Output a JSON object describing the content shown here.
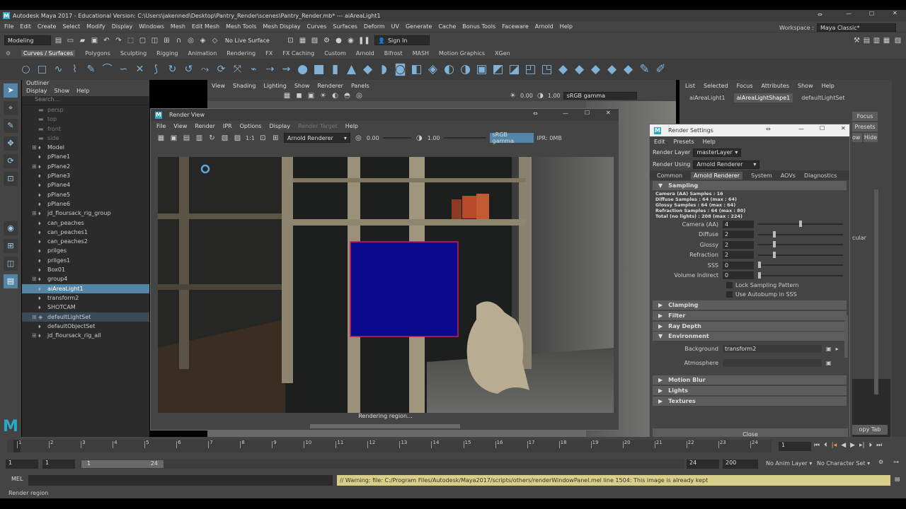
{
  "window": {
    "title": "Autodesk Maya 2017 - Educational Version: C:\\Users\\jakenned\\Desktop\\Pantry_Render\\scenes\\Pantry_Render.mb*   ---   aiAreaLight1"
  },
  "main_menu": [
    "File",
    "Edit",
    "Create",
    "Select",
    "Modify",
    "Display",
    "Windows",
    "Mesh",
    "Edit Mesh",
    "Mesh Tools",
    "Mesh Display",
    "Curves",
    "Surfaces",
    "Deform",
    "UV",
    "Generate",
    "Cache",
    "Bonus Tools",
    "Faceware",
    "Arnold",
    "Help"
  ],
  "workspace": {
    "label": "Workspace :",
    "value": "Maya Classic*"
  },
  "status": {
    "mode": "Modeling",
    "live_surface": "No Live Surface",
    "sign_in": "Sign In"
  },
  "shelf_tabs": [
    "Curves / Surfaces",
    "Polygons",
    "Sculpting",
    "Rigging",
    "Animation",
    "Rendering",
    "FX",
    "FX Caching",
    "Custom",
    "Arnold",
    "Bifrost",
    "MASH",
    "Motion Graphics",
    "XGen"
  ],
  "outliner": {
    "title": "Outliner",
    "menu": [
      "Display",
      "Show",
      "Help"
    ],
    "search_placeholder": "Search...",
    "items": [
      {
        "label": "persp",
        "dim": true,
        "exp": false
      },
      {
        "label": "top",
        "dim": true,
        "exp": false
      },
      {
        "label": "front",
        "dim": true,
        "exp": false
      },
      {
        "label": "side",
        "dim": true,
        "exp": false
      },
      {
        "label": "Model",
        "dim": false,
        "exp": true
      },
      {
        "label": "pPlane1",
        "dim": false,
        "exp": false
      },
      {
        "label": "pPlane2",
        "dim": false,
        "exp": true
      },
      {
        "label": "pPlane3",
        "dim": false,
        "exp": false
      },
      {
        "label": "pPlane4",
        "dim": false,
        "exp": false
      },
      {
        "label": "pPlane5",
        "dim": false,
        "exp": false
      },
      {
        "label": "pPlane6",
        "dim": false,
        "exp": false
      },
      {
        "label": "jd_floursack_rig_group",
        "dim": false,
        "exp": true
      },
      {
        "label": "can_peaches",
        "dim": false,
        "exp": false
      },
      {
        "label": "can_peaches1",
        "dim": false,
        "exp": false
      },
      {
        "label": "can_peaches2",
        "dim": false,
        "exp": false
      },
      {
        "label": "prilges",
        "dim": false,
        "exp": false
      },
      {
        "label": "prilges1",
        "dim": false,
        "exp": false
      },
      {
        "label": "Box01",
        "dim": false,
        "exp": false
      },
      {
        "label": "group4",
        "dim": false,
        "exp": true
      },
      {
        "label": "aiAreaLight1",
        "dim": false,
        "exp": false,
        "sel": true
      },
      {
        "label": "transform2",
        "dim": false,
        "exp": false
      },
      {
        "label": "SHOTCAM",
        "dim": false,
        "exp": false
      },
      {
        "label": "defaultLightSet",
        "dim": false,
        "exp": true,
        "set": true
      },
      {
        "label": "defaultObjectSet",
        "dim": false,
        "exp": false
      },
      {
        "label": "jd_floursack_rig_all",
        "dim": false,
        "exp": true
      }
    ]
  },
  "viewport": {
    "menu": [
      "View",
      "Shading",
      "Lighting",
      "Show",
      "Renderer",
      "Panels"
    ],
    "exposure": "0.00",
    "gamma": "1.00",
    "color_space": "sRGB gamma"
  },
  "attribute_editor": {
    "menu": [
      "List",
      "Selected",
      "Focus",
      "Attributes",
      "Show",
      "Help"
    ],
    "tabs": [
      "aiAreaLight1",
      "aiAreaLightShape1",
      "defaultLightSet"
    ],
    "focus_label": "Focus",
    "presets_label": "Presets",
    "show_label": "ow",
    "hide_label": "Hide",
    "partial_label": "cular",
    "copy_tab": "opy Tab"
  },
  "render_view": {
    "title": "Render View",
    "menu": [
      "File",
      "View",
      "Render",
      "IPR",
      "Options",
      "Display",
      "Render Target",
      "Help"
    ],
    "ratio": "1:1",
    "renderer": "Arnold Renderer",
    "exposure": "0.00",
    "gamma": "1.00",
    "color_space": "sRGB gamma",
    "ipr_mem": "IPR: 0MB",
    "status": "Rendering region..."
  },
  "render_settings": {
    "title": "Render Settings",
    "menu": [
      "Edit",
      "Presets",
      "Help"
    ],
    "render_layer_label": "Render Layer",
    "render_layer": "masterLayer",
    "render_using_label": "Render Using",
    "render_using": "Arnold Renderer",
    "tabs": [
      "Common",
      "Arnold Renderer",
      "System",
      "AOVs",
      "Diagnostics"
    ],
    "sampling_title": "Sampling",
    "info": [
      "Camera (AA) Samples : 16",
      "Diffuse Samples : 64 (max : 64)",
      "Glossy Samples : 64 (max : 64)",
      "Refraction Samples : 64 (max : 80)",
      "Total (no lights) : 208 (max : 224)"
    ],
    "fields": [
      {
        "label": "Camera (AA)",
        "value": "4",
        "pos": 0.5
      },
      {
        "label": "Diffuse",
        "value": "2",
        "pos": 0.18
      },
      {
        "label": "Glossy",
        "value": "2",
        "pos": 0.18
      },
      {
        "label": "Refraction",
        "value": "2",
        "pos": 0.18
      },
      {
        "label": "SSS",
        "value": "0",
        "pos": 0.0
      },
      {
        "label": "Volume Indirect",
        "value": "0",
        "pos": 0.0
      }
    ],
    "checks": [
      "Lock Sampling Pattern",
      "Use Autobump in SSS"
    ],
    "collapsed_a": [
      "Clamping",
      "Filter",
      "Ray Depth"
    ],
    "environment_title": "Environment",
    "background_label": "Background",
    "background_value": "transform2",
    "atmosphere_label": "Atmosphere",
    "collapsed_b": [
      "Motion Blur",
      "Lights",
      "Textures"
    ],
    "close": "Close"
  },
  "timeline": {
    "ticks": [
      1,
      2,
      3,
      4,
      5,
      6,
      7,
      8,
      9,
      10,
      11,
      12,
      13,
      14,
      15,
      16,
      17,
      18,
      19,
      20,
      21,
      22,
      23,
      24
    ],
    "current_frame": "1",
    "range_start": "1",
    "range_start2": "1",
    "slider_start": "1",
    "slider_end": "24",
    "range_end": "24",
    "anim_end": "200",
    "anim_layer": "No Anim Layer",
    "character_set": "No Character Set"
  },
  "command_line": {
    "mode": "MEL",
    "message": "// Warning: file: C:/Program Files/Autodesk/Maya2017/scripts/others/renderWindowPanel.mel line 1504: This image is already kept"
  },
  "help_line": "Render region",
  "colors": {
    "accent": "#5285a6",
    "region_fill": "#0a0a8c",
    "region_border": "#d01a5a",
    "warning_bg": "#d9cf8a"
  }
}
